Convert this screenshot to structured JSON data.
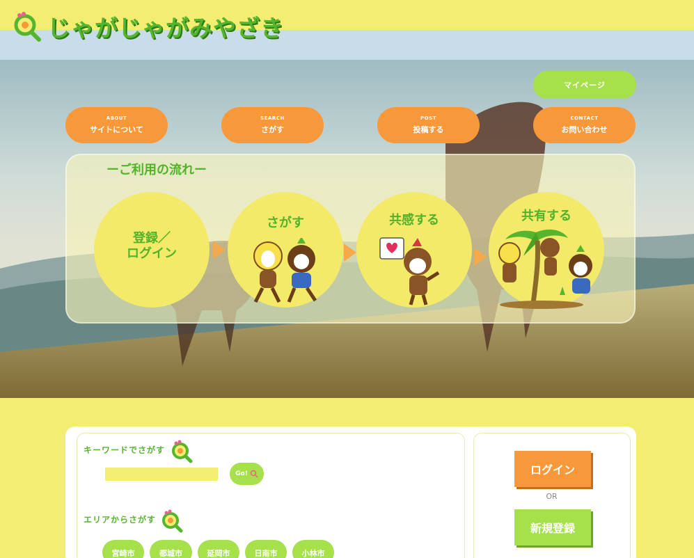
{
  "header": {
    "logo_text": "じゃがじゃがみやざき",
    "logo_icon": "magnifier-flower-icon"
  },
  "nav": {
    "mypage": "マイページ",
    "items": [
      {
        "en": "ABOUT",
        "ja": "サイトについて"
      },
      {
        "en": "SEARCH",
        "ja": "さがす"
      },
      {
        "en": "POST",
        "ja": "投稿する"
      },
      {
        "en": "CONTACT",
        "ja": "お問い合わせ"
      }
    ]
  },
  "flow": {
    "title": "ーご利用の流れー",
    "steps": [
      {
        "label_line1": "登録／",
        "label_line2": "ログイン"
      },
      {
        "label": "さがす"
      },
      {
        "label": "共感する"
      },
      {
        "label": "共有する"
      }
    ]
  },
  "search": {
    "keyword_label": "キーワードでさがす",
    "keyword_value": "",
    "go_label": "Go!",
    "area_label": "エリアからさがす",
    "areas": [
      "宮崎市",
      "都城市",
      "延岡市",
      "日南市",
      "小林市"
    ]
  },
  "account": {
    "login": "ログイン",
    "or": "OR",
    "signup": "新規登録"
  },
  "colors": {
    "yellow": "#f3ee72",
    "green": "#a6e04b",
    "orange": "#f7993a",
    "text_green": "#56b52e"
  }
}
